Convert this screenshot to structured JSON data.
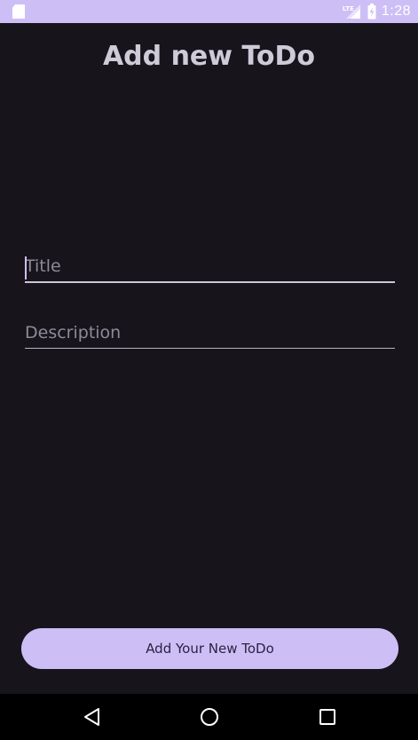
{
  "status_bar": {
    "time": "1:28",
    "network_label": "LTE",
    "icons": [
      "sd-card-icon",
      "lte-signal-icon",
      "battery-charging-icon"
    ],
    "background_color": "#cdbff5"
  },
  "page": {
    "title": "Add new ToDo",
    "background_color": "#17141c"
  },
  "form": {
    "title_field": {
      "value": "",
      "placeholder": "Title",
      "focused": true
    },
    "description_field": {
      "value": "",
      "placeholder": "Description",
      "focused": false
    }
  },
  "actions": {
    "add_button_label": "Add Your New ToDo",
    "accent_color": "#cdbff5"
  },
  "navigation": {
    "buttons": [
      "back-icon",
      "home-icon",
      "recents-icon"
    ]
  }
}
